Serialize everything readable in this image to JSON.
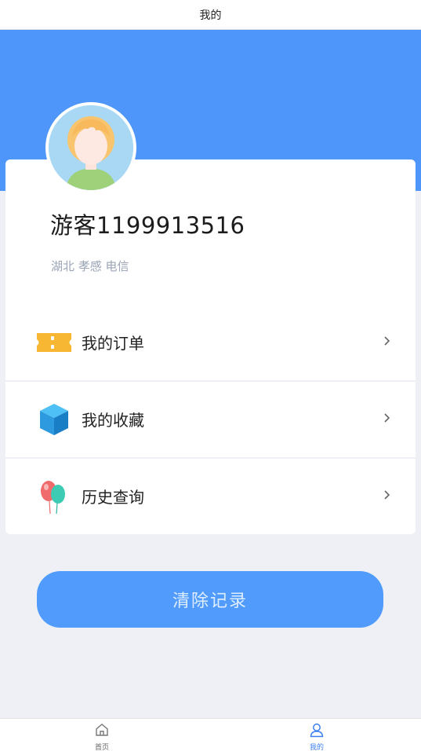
{
  "header": {
    "title": "我的"
  },
  "profile": {
    "username": "游客1199913516",
    "location": "湖北 孝感 电信"
  },
  "menu": [
    {
      "label": "我的订单",
      "icon": "ticket-icon"
    },
    {
      "label": "我的收藏",
      "icon": "cube-icon"
    },
    {
      "label": "历史查询",
      "icon": "balloons-icon"
    }
  ],
  "actions": {
    "clear_label": "清除记录"
  },
  "tabbar": {
    "tabs": [
      {
        "label": "首页",
        "icon": "home-icon",
        "active": false
      },
      {
        "label": "我的",
        "icon": "user-icon",
        "active": true
      }
    ]
  },
  "colors": {
    "accent": "#4f96fb",
    "button": "#519bfc",
    "background": "#eef0f6"
  }
}
